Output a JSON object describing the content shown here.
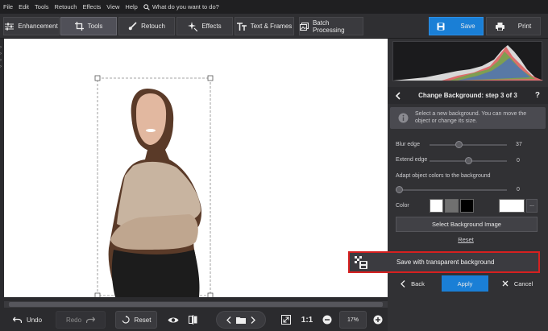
{
  "menu": {
    "items": [
      "File",
      "Edit",
      "Tools",
      "Retouch",
      "Effects",
      "View",
      "Help"
    ],
    "search_placeholder": "What do you want to do?"
  },
  "tabs": [
    {
      "label": "Enhancement",
      "icon": "sliders-icon"
    },
    {
      "label": "Tools",
      "icon": "crop-icon"
    },
    {
      "label": "Retouch",
      "icon": "brush-icon"
    },
    {
      "label": "Effects",
      "icon": "sparkle-icon"
    },
    {
      "label": "Text & Frames",
      "icon": "text-icon"
    },
    {
      "label": "Batch Processing",
      "icon": "images-icon"
    }
  ],
  "actions": {
    "save": "Save",
    "print": "Print"
  },
  "bottom": {
    "undo": "Undo",
    "redo": "Redo",
    "reset": "Reset",
    "one_to_one": "1:1",
    "zoom": "17%"
  },
  "panel": {
    "step_title": "Change Background: step 3 of 3",
    "help": "?",
    "info_text": "Select a new background. You can move the object or change its size.",
    "blur_edge_label": "Blur edge",
    "blur_edge_value": "37",
    "blur_edge_level": 0.37,
    "extend_edge_label": "Extend edge",
    "extend_edge_value": "0",
    "extend_edge_level": 0.5,
    "adapt_label": "Adapt object colors to the background",
    "adapt_value": "0",
    "adapt_level": 0.0,
    "color_label": "Color",
    "swatches": [
      "#ffffff",
      "#707070",
      "#000000"
    ],
    "custom_color": "#ffffff",
    "more": "...",
    "select_bg": "Select Background Image",
    "reset_link": "Reset",
    "save_transparent": "Save with transparent background",
    "back": "Back",
    "apply": "Apply",
    "cancel": "Cancel"
  },
  "colors": {
    "accent": "#1a7fd6",
    "highlight_border": "#d62020"
  }
}
